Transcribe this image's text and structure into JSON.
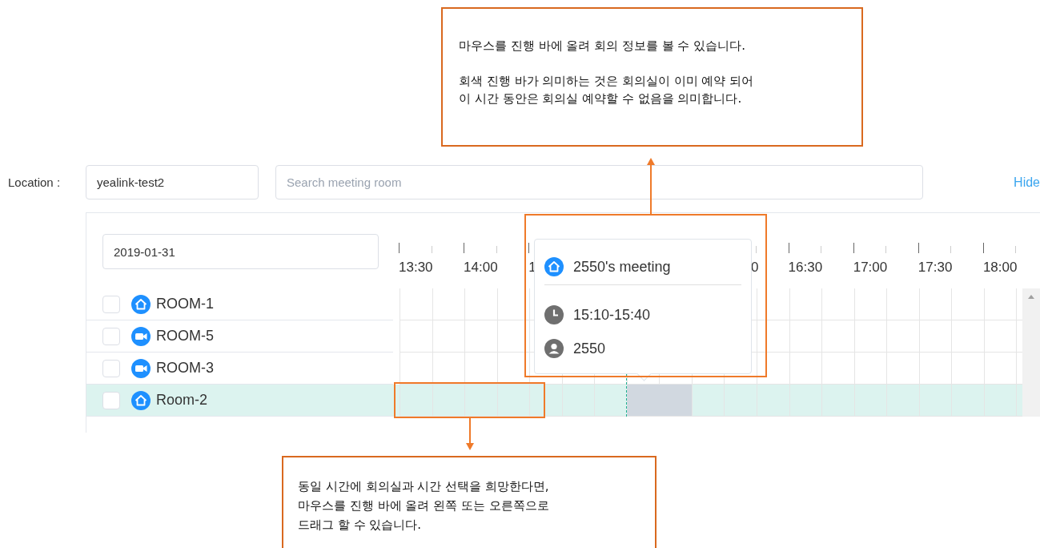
{
  "callouts": [
    {
      "kind": "top",
      "paragraphs": [
        "마우스를 진행 바에 올려 회의 정보를 볼 수 있습니다.",
        "회색 진행 바가 의미하는 것은 회의실이 이미 예약 되어\n이 시간 동안은 회의실 예약할 수 없음을 의미합니다."
      ]
    },
    {
      "kind": "bottom",
      "paragraphs": [
        "동일 시간에 회의실과 시간 선택을 희망한다면,\n마우스를 진행 바에 올려 왼쪽 또는 오른쪽으로\n드래그 할 수 있습니다."
      ]
    }
  ],
  "filters": {
    "location_label": "Location :",
    "location_value": "yealink-test2",
    "search_placeholder": "Search meeting room",
    "hide_link": "Hide"
  },
  "date": "2019-01-31",
  "axis": {
    "left_labels": [
      "13:30",
      "14:00",
      "1"
    ],
    "right_labels": [
      "0",
      "16:30",
      "17:00",
      "17:30",
      "18:00"
    ]
  },
  "rooms": [
    {
      "name": "ROOM-1",
      "kind": "home",
      "checked": false,
      "selected": false
    },
    {
      "name": "ROOM-5",
      "kind": "video",
      "checked": false,
      "selected": false
    },
    {
      "name": "ROOM-3",
      "kind": "video",
      "checked": false,
      "selected": false
    },
    {
      "name": "Room-2",
      "kind": "home",
      "checked": false,
      "selected": true,
      "busy": true
    }
  ],
  "tooltip": {
    "title": "2550's meeting",
    "time": "15:10-15:40",
    "organizer": "2550"
  }
}
